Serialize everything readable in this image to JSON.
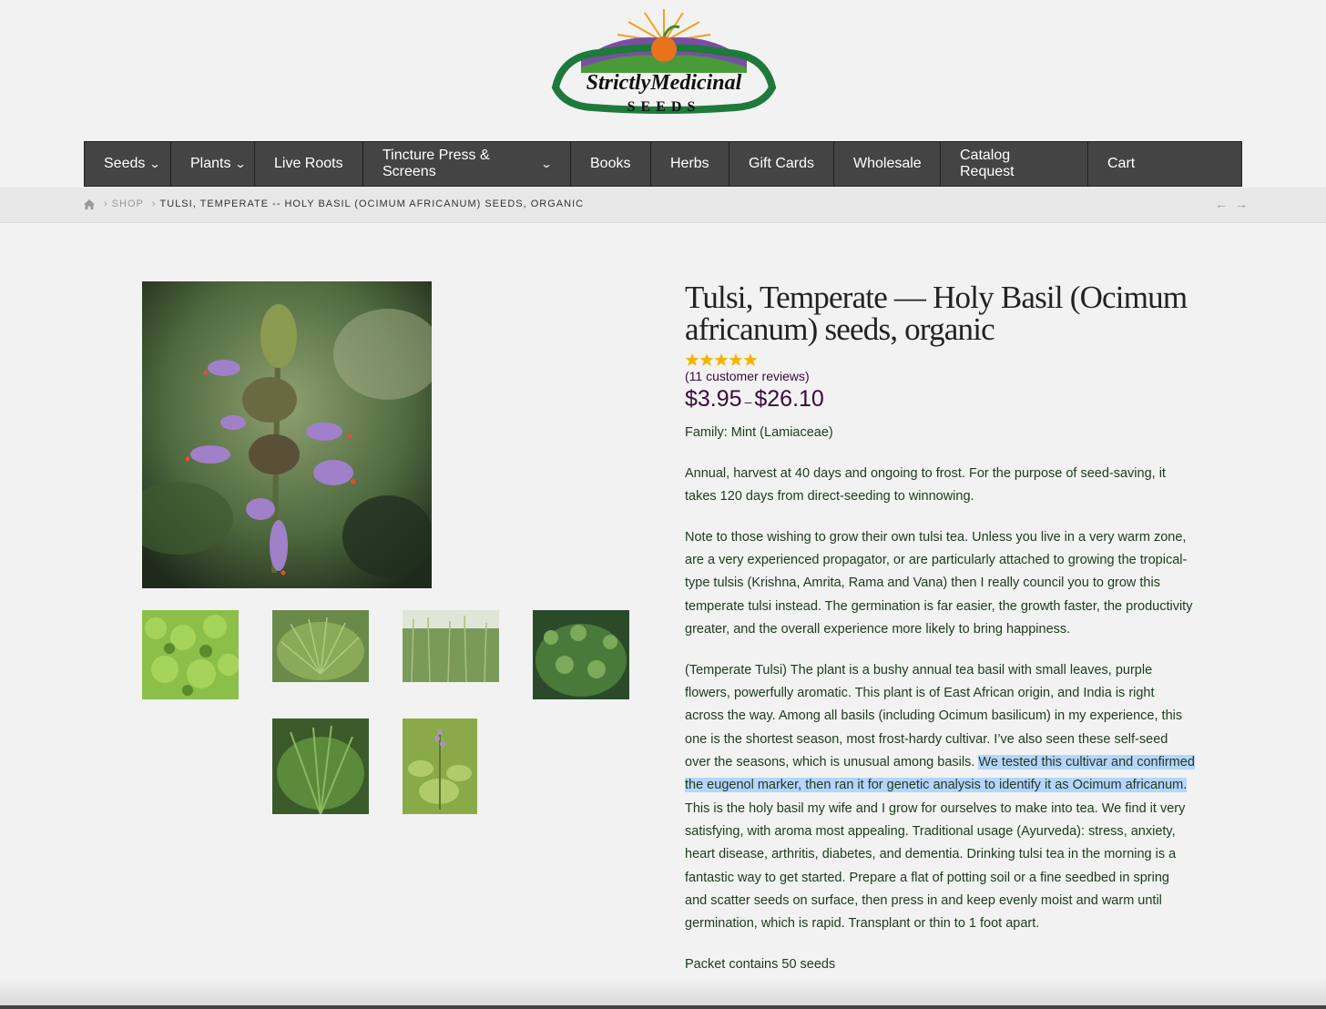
{
  "brand": {
    "logo_line1": "StrictlyMedicinal",
    "logo_line2": "SEEDS",
    "colors": {
      "green": "#1e7a3a",
      "orange": "#e8731c",
      "purple": "#6a3d8a"
    }
  },
  "nav": {
    "items": [
      {
        "label": "Seeds",
        "dropdown": true
      },
      {
        "label": "Plants",
        "dropdown": true
      },
      {
        "label": "Live Roots",
        "dropdown": false
      },
      {
        "label": "Tincture Press & Screens",
        "dropdown": true
      },
      {
        "label": "Books",
        "dropdown": false
      },
      {
        "label": "Herbs",
        "dropdown": false
      },
      {
        "label": "Gift Cards",
        "dropdown": false
      },
      {
        "label": "Wholesale",
        "dropdown": false
      },
      {
        "label": "Catalog Request",
        "dropdown": false
      },
      {
        "label": "Cart",
        "dropdown": false
      }
    ]
  },
  "breadcrumb": {
    "home_icon": "home-icon",
    "shop": "SHOP",
    "current": "TULSI, TEMPERATE -- HOLY BASIL (OCIMUM AFRICANUM) SEEDS, ORGANIC",
    "prev_icon": "arrow-left-icon",
    "next_icon": "arrow-right-icon"
  },
  "product": {
    "title": "Tulsi, Temperate — Holy Basil (Ocimum africanum) seeds, organic",
    "rating_stars": 5,
    "reviews": "(11 customer reviews)",
    "price_low": "$3.95",
    "price_sep": "–",
    "price_high": "$26.10",
    "family": "Family:  Mint (Lamiaceae)",
    "p1": "Annual, harvest at 40 days and ongoing to frost.  For the purpose of seed-saving, it takes 120 days from direct-seeding to winnowing.",
    "p2": "Note to those wishing to grow their own tulsi tea.  Unless you live in a very warm zone, are a very experienced propagator, or are particularly attached to growing the tropical-type tulsis (Krishna, Amrita, Rama and Vana) then I really council you to grow this temperate tulsi instead.  The germination is far easier, the growth faster, the productivity  greater, and the overall experience more likely to bring happiness.",
    "p3_before": "(Temperate Tulsi)  The plant is a bushy annual tea basil with small leaves, purple flowers, powerfully aromatic.  This plant is of East African origin, and India is right across the way.  Among all basils (including Ocimum basilicum) in my experience, this one is the shortest season, most frost-hardy cultivar. I’ve also seen these self-seed over the seasons, which is unusual among basils.  ",
    "p3_highlight": "We tested this cultivar and confirmed the eugenol marker, then ran it for genetic analysis to identify it as Ocimum africanum.  ",
    "p3_after": "This is the holy basil my wife and I grow for ourselves to make into tea.  We find it very satisfying, with aroma most appealing.   Traditional usage (Ayurveda): stress, anxiety, heart disease, arthritis, diabetes, and dementia.  Drinking tulsi tea in the morning is a fantastic way to get started.  Prepare a flat of potting soil or a fine seedbed in spring and scatter seeds on surface, then press in and keep evenly moist and warm until germination, which is rapid.  Transplant or thin to 1 foot apart.",
    "packet": "Packet contains 50 seeds",
    "colors": {
      "price": "#3b0a3b",
      "text": "#1d3a1d",
      "highlight": "#b4d5fe",
      "star": "#f5b301"
    }
  }
}
